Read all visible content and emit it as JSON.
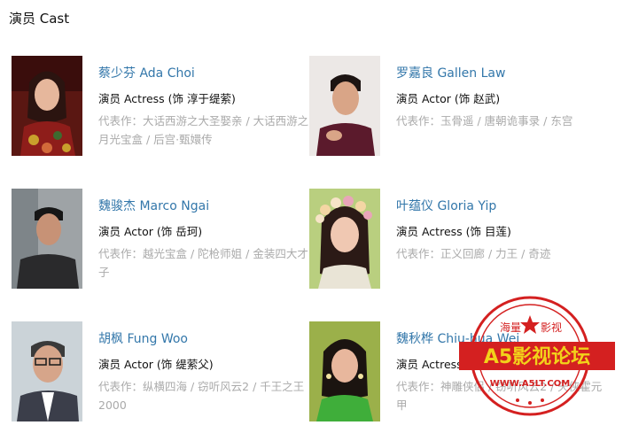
{
  "section": {
    "title": "演员 Cast"
  },
  "cast": [
    {
      "name": "蔡少芬 Ada Choi",
      "role": "演员 Actress (饰 淳于缇萦)",
      "works_label": "代表作：",
      "works": "大话西游之大圣娶亲 / 大话西游之月光宝盒 / 后宫·甄嬛传"
    },
    {
      "name": "罗嘉良 Gallen Law",
      "role": "演员 Actor (饰 赵武)",
      "works_label": "代表作：",
      "works": "玉骨遥 / 唐朝诡事录 / 东宫"
    },
    {
      "name": "魏骏杰 Marco Ngai",
      "role": "演员 Actor (饰 岳珂)",
      "works_label": "代表作：",
      "works": "越光宝盒 / 陀枪师姐 / 金装四大才子"
    },
    {
      "name": "叶蕴仪 Gloria Yip",
      "role": "演员 Actress (饰 目莲)",
      "works_label": "代表作：",
      "works": "正义回廊 / 力王 / 奇迹"
    },
    {
      "name": "胡枫 Fung Woo",
      "role": "演员 Actor (饰 缇萦父)",
      "works_label": "代表作：",
      "works": "纵横四海 / 窃听风云2 / 千王之王2000"
    },
    {
      "name": "魏秋桦 Chiu-hua Wei",
      "role": "演员 Actress (饰 刘晋母)",
      "works_label": "代表作：",
      "works": "神雕侠侣 / 窃听风云2 / 天侠霍元甲"
    }
  ],
  "watermark": {
    "top_left": "海量",
    "top_right": "影视",
    "main": "A5影视论坛",
    "url": "WWW.A5LT.COM"
  },
  "colors": {
    "link": "#3377aa",
    "muted": "#aaaaaa",
    "stamp": "#d42020",
    "stamp_text": "#f2d21a"
  }
}
